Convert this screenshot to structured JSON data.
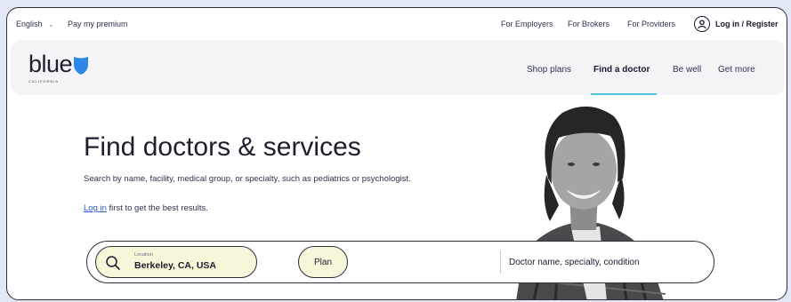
{
  "utility_bar": {
    "language": "English",
    "pay_premium": "Pay my premium",
    "for_employers": "For Employers",
    "for_brokers": "For Brokers",
    "for_providers": "For Providers",
    "login": "Log in / Register"
  },
  "brand": {
    "logo_word": "blue",
    "logo_sub": "CALIFORNIA",
    "shield_color": "#2e86e6"
  },
  "nav": {
    "shop_plans": "Shop plans",
    "find_doctor": "Find a doctor",
    "be_well": "Be well",
    "get_more": "Get more",
    "active_color": "#4fc3e0"
  },
  "hero": {
    "title": "Find doctors & services",
    "description": "Search by name, facility, medical group, or specialty, such as pediatrics or psychologist.",
    "login_link": "Log in",
    "login_suffix": " first to get the best results."
  },
  "search": {
    "location_label": "Location",
    "location_value": "Berkeley, CA, USA",
    "plan_label": "Plan",
    "doctor_placeholder": "Doctor name, specialty, condition"
  }
}
